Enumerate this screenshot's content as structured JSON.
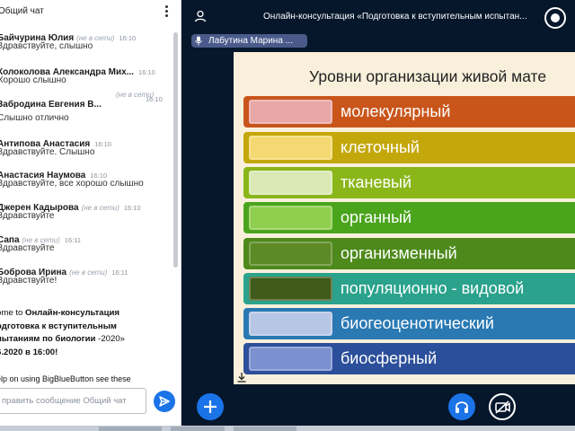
{
  "chat": {
    "title": "Общий чат",
    "messages": [
      {
        "name": "Байчурина Юлия",
        "status": "(не в сети)",
        "time": "16:10",
        "text": "Здравствуйте, слышно"
      },
      {
        "name": "Колоколова Александра Мих...",
        "status": "",
        "time": "16:10",
        "text": "Хорошо слышно"
      },
      {
        "name": "Забродина Евгения В...",
        "status": "(не в сети)",
        "time": "16:10",
        "text": "Слышно отлично"
      },
      {
        "name": "Антипова Анастасия",
        "status": "",
        "time": "16:10",
        "text": "Здравствуйте. Слышно"
      },
      {
        "name": "Анастасия Наумова",
        "status": "",
        "time": "16:10",
        "text": "Здравствуйте, все хорошо слышно"
      },
      {
        "name": "Джерен Кадырова",
        "status": "(не в сети)",
        "time": "16:10",
        "text": "Здравствуйте"
      },
      {
        "name": "Сапа",
        "status": "(не в сети)",
        "time": "16:11",
        "text": "Здравствуйте"
      },
      {
        "name": "Боброва Ирина",
        "status": "(не в сети)",
        "time": "16:11",
        "text": "Здравствуйте!"
      }
    ],
    "welcome_prefix": "ome to ",
    "welcome_bold_1": "Онлайн-консультация",
    "welcome_bold_2": "одготовка к вступительным",
    "welcome_bold_3": "пытаниям по биологии",
    "welcome_date_prefix": "-2020»",
    "welcome_bold_4": "6.2020 в 16:00!",
    "help_text": "elp on using BigBlueButton see these",
    "input_placeholder": "править сообщение Общий чат"
  },
  "topbar": {
    "meeting_title": "Онлайн-консультация «Подготовка к вступительным испытан..."
  },
  "talker": {
    "name": "Лабутина Марина ..."
  },
  "slide": {
    "title": "Уровни организации живой мате",
    "levels": [
      {
        "label": "молекулярный",
        "bar_color": "#c9551a",
        "swatch_color": "#e8a7a7"
      },
      {
        "label": "клеточный",
        "bar_color": "#c4a70a",
        "swatch_color": "#f6d872"
      },
      {
        "label": "тканевый",
        "bar_color": "#8ab61a",
        "swatch_color": "#d9e8b4"
      },
      {
        "label": "органный",
        "bar_color": "#4aa41c",
        "swatch_color": "#8fce4f"
      },
      {
        "label": "организменный",
        "bar_color": "#4d8a1b",
        "swatch_color": "#5d8a26"
      },
      {
        "label": "популяционно - видовой",
        "bar_color": "#2aa28c",
        "swatch_color": "#3f5a1a"
      },
      {
        "label": "биогеоценотический",
        "bar_color": "#2a79b3",
        "swatch_color": "#b8c6e6"
      },
      {
        "label": "биосферный",
        "bar_color": "#2b4f9a",
        "swatch_color": "#7b90cf"
      }
    ]
  },
  "icons": {
    "kebab": "more-vertical-icon",
    "user": "user-icon",
    "record": "record-icon",
    "mic": "microphone-icon",
    "download": "download-icon",
    "add": "plus-icon",
    "audio": "headphones-icon",
    "video": "camera-off-icon",
    "send": "send-icon"
  }
}
